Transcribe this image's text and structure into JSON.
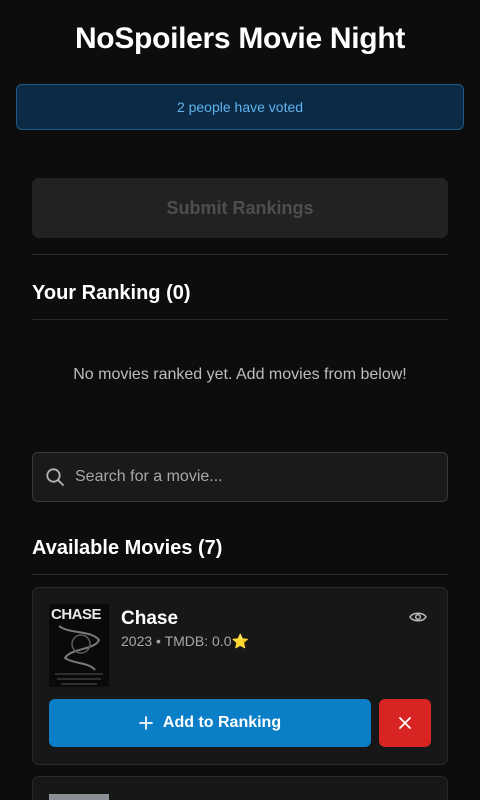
{
  "app": {
    "title": "NoSpoilers Movie Night"
  },
  "vote_banner": {
    "text": "2 people have voted"
  },
  "submit": {
    "label": "Submit Rankings"
  },
  "ranking": {
    "heading": "Your Ranking (0)",
    "empty_message": "No movies ranked yet. Add movies from below!"
  },
  "search": {
    "placeholder": "Search for a movie..."
  },
  "available": {
    "heading": "Available Movies (7)",
    "movies": [
      {
        "title": "Chase",
        "meta": "2023 • TMDB: 0.0⭐",
        "poster_text": "CHASE",
        "add_label": "Add to Ranking"
      }
    ]
  },
  "colors": {
    "background": "#0d0d0d",
    "banner_text": "#5fb3ee",
    "primary": "#0a7fc8",
    "danger": "#d92424"
  },
  "icons": {
    "search": "search-icon",
    "eye": "eye-icon",
    "plus": "plus-icon",
    "close": "close-icon"
  }
}
